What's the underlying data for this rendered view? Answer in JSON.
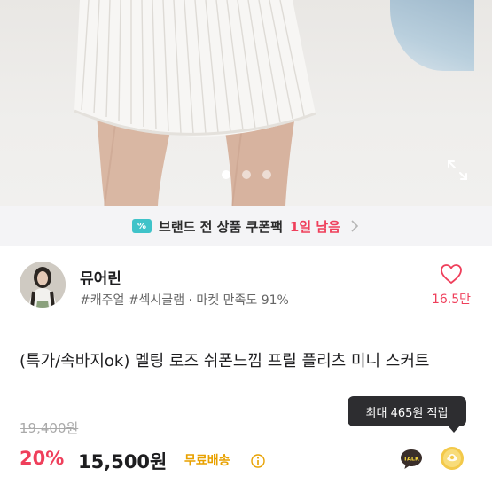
{
  "hero": {
    "carousel_total": 3,
    "carousel_active": 1
  },
  "coupon": {
    "icon_text": "%",
    "label": "브랜드 전 상품 쿠폰팩",
    "remaining": "1일 남음"
  },
  "shop": {
    "name": "뮤어린",
    "tags": "#캐주얼 #섹시글램 · 마켓 만족도 91%",
    "likes": "16.5만"
  },
  "product": {
    "title": "(특가/속바지ok) 멜팅 로즈 쉬폰느낌 프릴 플리츠 미니 스커트",
    "original_price": "19,400원",
    "discount": "20%",
    "price": "15,500원",
    "shipping": "무료배송"
  },
  "points_tooltip": "최대 465원 적립",
  "talk_label": "TALK",
  "colors": {
    "accent": "#ef3f5b",
    "shipping": "#e8a100",
    "coupon_icon": "#3fc3c9"
  }
}
